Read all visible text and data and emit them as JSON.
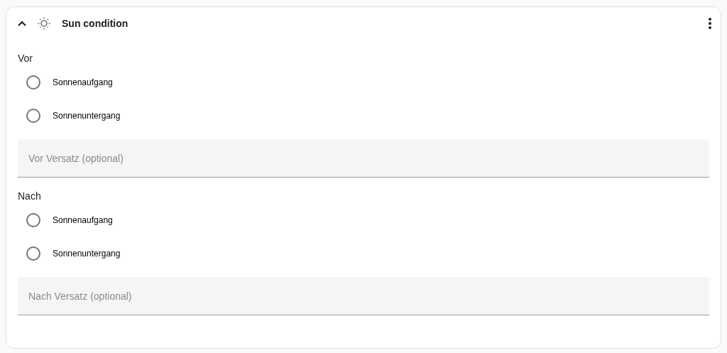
{
  "header": {
    "title": "Sun condition",
    "expanded": true
  },
  "groups": [
    {
      "label": "Vor",
      "options": [
        {
          "label": "Sonnenaufgang",
          "selected": false
        },
        {
          "label": "Sonnenuntergang",
          "selected": false
        }
      ],
      "field": {
        "placeholder": "Vor Versatz (optional)"
      }
    },
    {
      "label": "Nach",
      "options": [
        {
          "label": "Sonnenaufgang",
          "selected": false
        },
        {
          "label": "Sonnenuntergang",
          "selected": false
        }
      ],
      "field": {
        "placeholder": "Nach Versatz (optional)"
      }
    }
  ]
}
